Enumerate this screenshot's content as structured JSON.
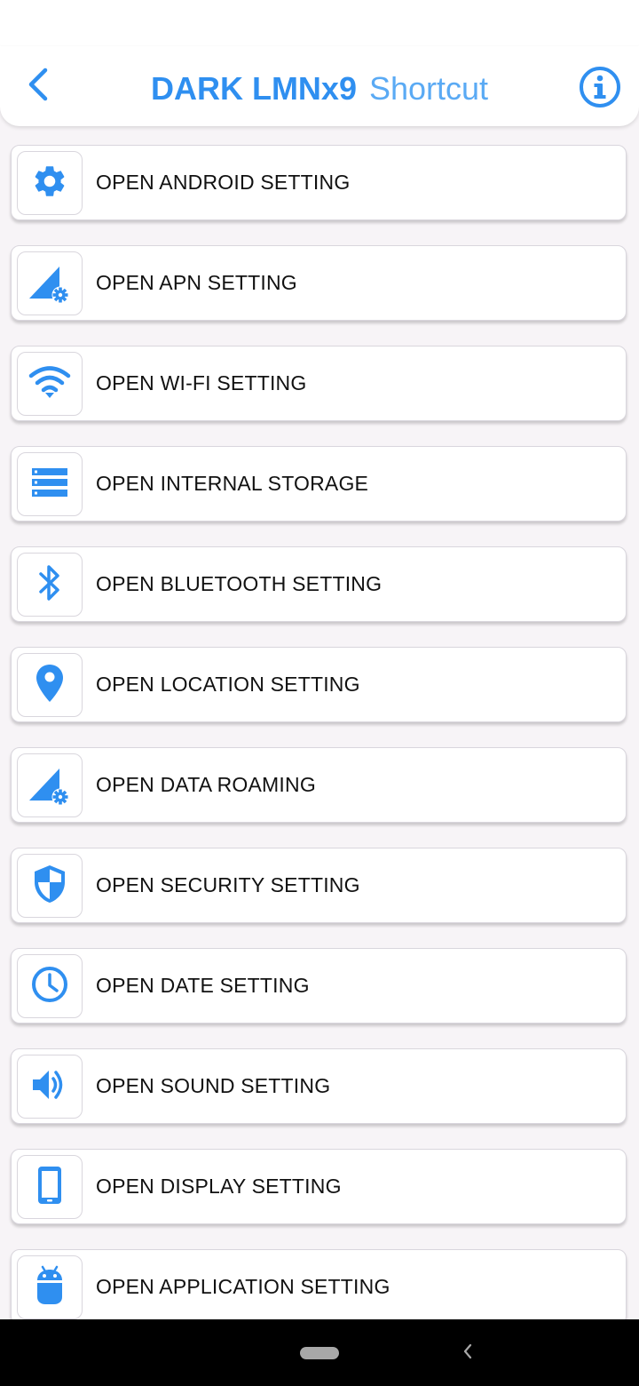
{
  "app": {
    "title_bold": "DARK LMNx9",
    "title_light": "Shortcut"
  },
  "colors": {
    "accent": "#2f8ff0",
    "accent_light": "#5aaaf4",
    "background": "#f7f4f7",
    "card": "#ffffff"
  },
  "items": [
    {
      "label": "OPEN ANDROID SETTING",
      "icon": "gear-icon"
    },
    {
      "label": "OPEN APN SETTING",
      "icon": "signal-settings-icon"
    },
    {
      "label": "OPEN WI-FI SETTING",
      "icon": "wifi-icon"
    },
    {
      "label": "OPEN INTERNAL STORAGE",
      "icon": "storage-icon"
    },
    {
      "label": "OPEN BLUETOOTH SETTING",
      "icon": "bluetooth-icon"
    },
    {
      "label": "OPEN LOCATION SETTING",
      "icon": "location-pin-icon"
    },
    {
      "label": "OPEN DATA ROAMING",
      "icon": "signal-settings-icon"
    },
    {
      "label": "OPEN SECURITY SETTING",
      "icon": "shield-icon"
    },
    {
      "label": "OPEN DATE SETTING",
      "icon": "clock-icon"
    },
    {
      "label": "OPEN SOUND SETTING",
      "icon": "speaker-icon"
    },
    {
      "label": "OPEN DISPLAY SETTING",
      "icon": "phone-icon"
    },
    {
      "label": "OPEN APPLICATION SETTING",
      "icon": "android-icon"
    }
  ]
}
